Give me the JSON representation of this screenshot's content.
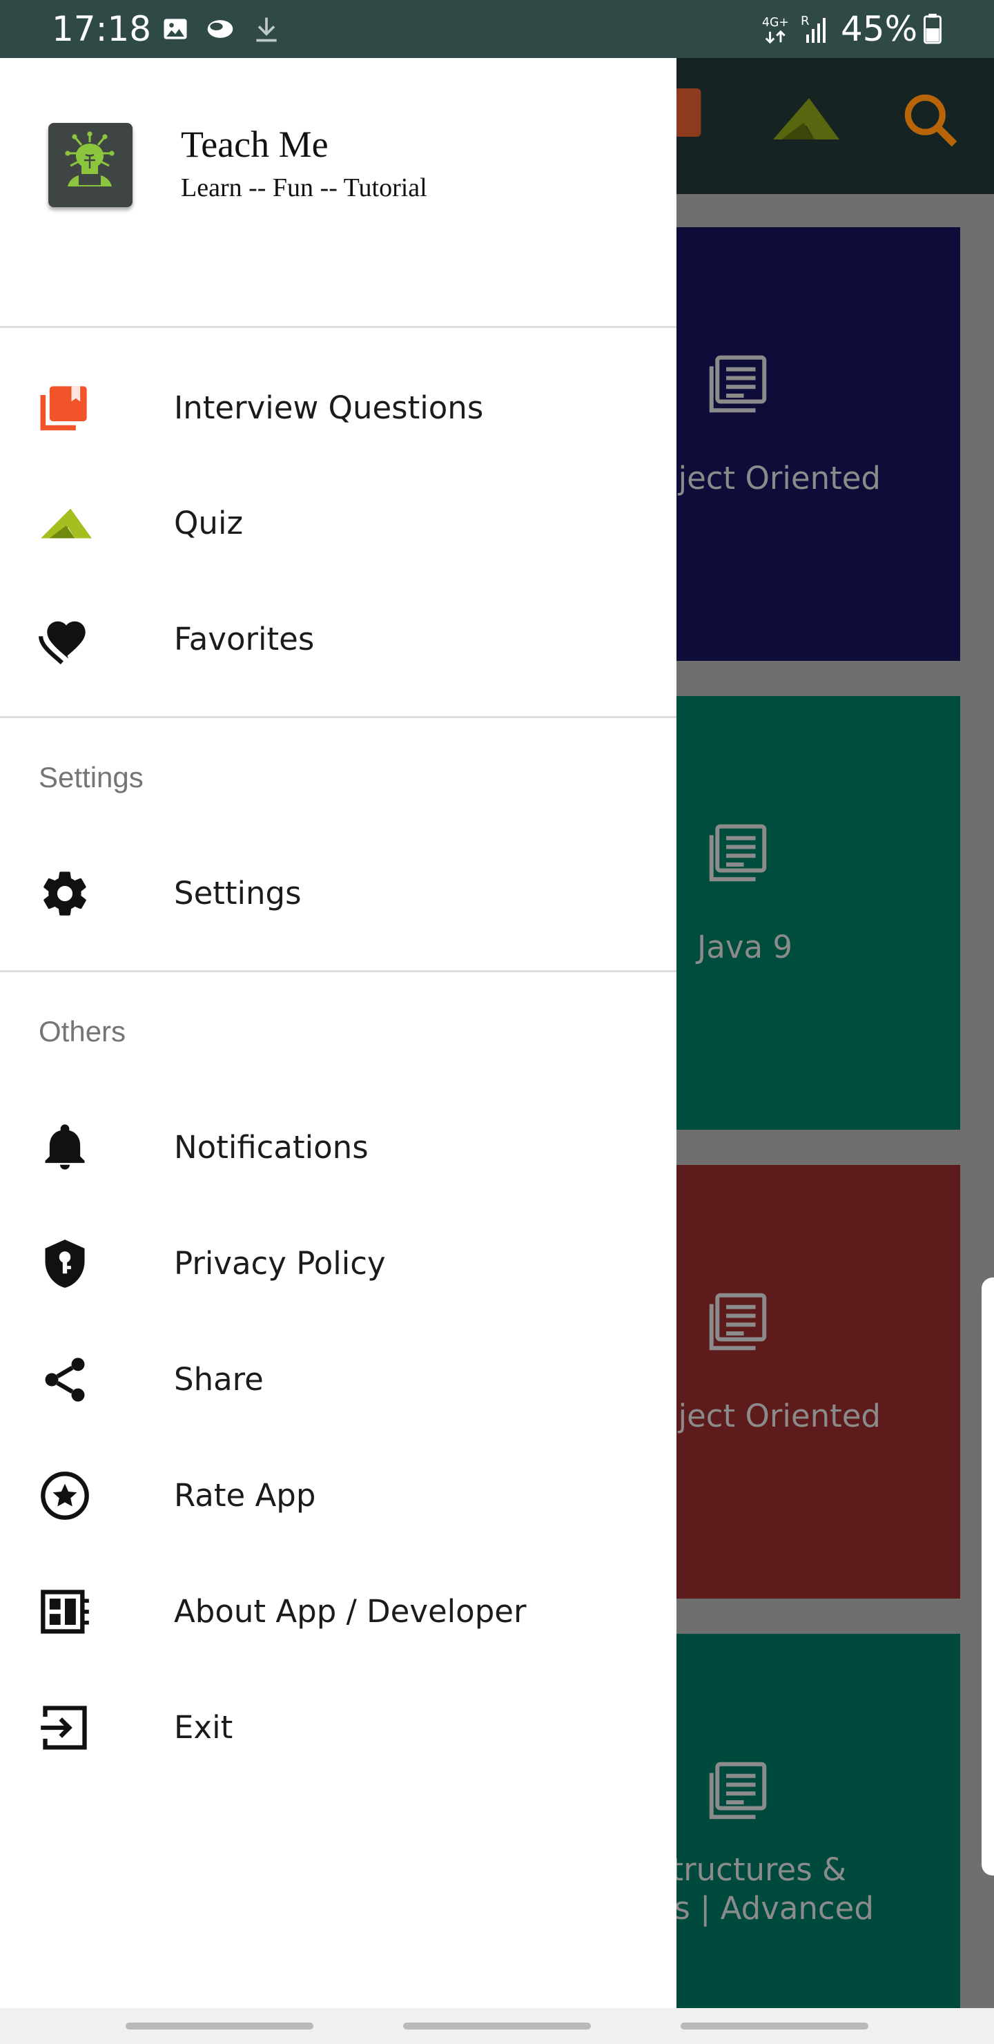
{
  "status_bar": {
    "time": "17:18",
    "battery": "45%",
    "icons": [
      "gallery-icon",
      "cloud-icon",
      "download-icon",
      "4g-signal-icon",
      "signal-icon",
      "battery-icon"
    ]
  },
  "background_app": {
    "cards": [
      {
        "title": "bject Oriented",
        "color": "#0e0d3a"
      },
      {
        "title": "Java 9",
        "color": "#014d3d"
      },
      {
        "title": "bject Oriented",
        "color": "#5e1b1b"
      },
      {
        "title": "Structures &\nhms | Advanced",
        "color": "#004a3d"
      }
    ],
    "toolbar_icons": [
      "book-icon",
      "quiz-icon",
      "search-icon"
    ]
  },
  "drawer": {
    "header": {
      "title": "Teach Me",
      "subtitle": "Learn -- Fun -- Tutorial"
    },
    "main_items": [
      {
        "label": "Interview Questions",
        "icon": "book-icon"
      },
      {
        "label": "Quiz",
        "icon": "quiz-icon"
      },
      {
        "label": "Favorites",
        "icon": "heart-icon"
      }
    ],
    "settings_section": {
      "title": "Settings",
      "items": [
        {
          "label": "Settings",
          "icon": "gear-icon"
        }
      ]
    },
    "others_section": {
      "title": "Others",
      "items": [
        {
          "label": "Notifications",
          "icon": "bell-icon"
        },
        {
          "label": "Privacy Policy",
          "icon": "shield-key-icon"
        },
        {
          "label": "Share",
          "icon": "share-icon"
        },
        {
          "label": "Rate App",
          "icon": "star-circle-icon"
        },
        {
          "label": "About App / Developer",
          "icon": "about-icon"
        },
        {
          "label": "Exit",
          "icon": "exit-icon"
        }
      ]
    }
  },
  "colors": {
    "status_bar": "#2f4a46",
    "accent_book": "#f2542a",
    "accent_quiz": "#99b31a",
    "search": "#b8650a"
  }
}
